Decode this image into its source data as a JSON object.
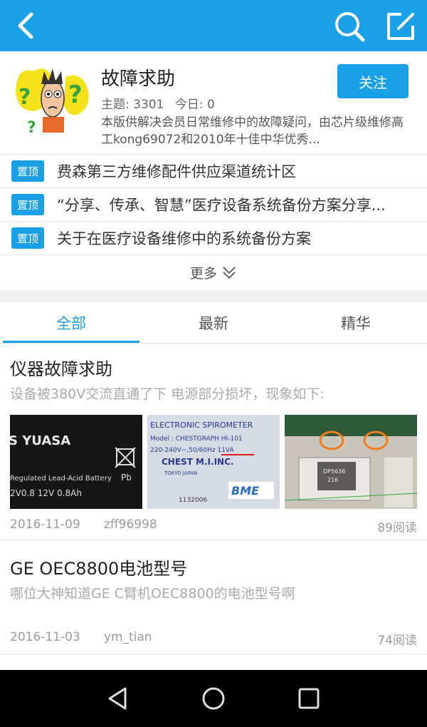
{
  "topbar": {
    "back_icon": "back-arrow-icon",
    "search_icon": "search-icon",
    "compose_icon": "compose-icon",
    "color": "#1aa0e6"
  },
  "forum": {
    "title": "故障求助",
    "topics_label": "主题: 3301",
    "today_label": "今日: 0",
    "description": "本版供解决会员日常维修中的故障疑问，由芯片级维修高工kong69072和2010年十佳中华优秀...",
    "follow_label": "关注"
  },
  "pinned": {
    "tag": "置顶",
    "items": [
      {
        "text": "费森第三方维修配件供应渠道统计区"
      },
      {
        "text": "“分享、传承、智慧”医疗设备系统备份方案分享..."
      },
      {
        "text": "关于在医疗设备维修中的系统备份方案"
      }
    ],
    "more_label": "更多"
  },
  "tabs": [
    {
      "label": "全部",
      "active": true
    },
    {
      "label": "最新",
      "active": false
    },
    {
      "label": "精华",
      "active": false
    }
  ],
  "posts": [
    {
      "title": "仪器故障求助",
      "excerpt": "设备被380V交流直通了下 电源部分损坏，现象如下:",
      "thumbs": [
        {
          "line1": "S YUASA",
          "line2": "Regulated Lead-Acid Battery",
          "line3": "2V0.8    12V 0.8Ah",
          "corner": "Pb"
        },
        {
          "line1": "ELECTRONIC SPIROMETER",
          "line2": "Model : CHESTGRAPH HI-101",
          "line3": "220-240V~,50/60Hz 11VA",
          "line4": "CHEST M.I.INC.",
          "line5": "TOKYO JAPAN",
          "line6": "1132006",
          "brand": "BME"
        },
        {
          "line1": "DP5636",
          "line2": "216"
        }
      ],
      "date": "2016-11-09",
      "user": "zff96998",
      "views": "89阅读"
    },
    {
      "title": "GE OEC8800电池型号",
      "excerpt": "哪位大神知道GE C臂机OEC8800的电池型号啊",
      "date": "2016-11-03",
      "user": "ym_tian",
      "views": "74阅读"
    }
  ],
  "navbar": {
    "back": "nav-back-icon",
    "home": "nav-home-icon",
    "recents": "nav-recents-icon"
  }
}
